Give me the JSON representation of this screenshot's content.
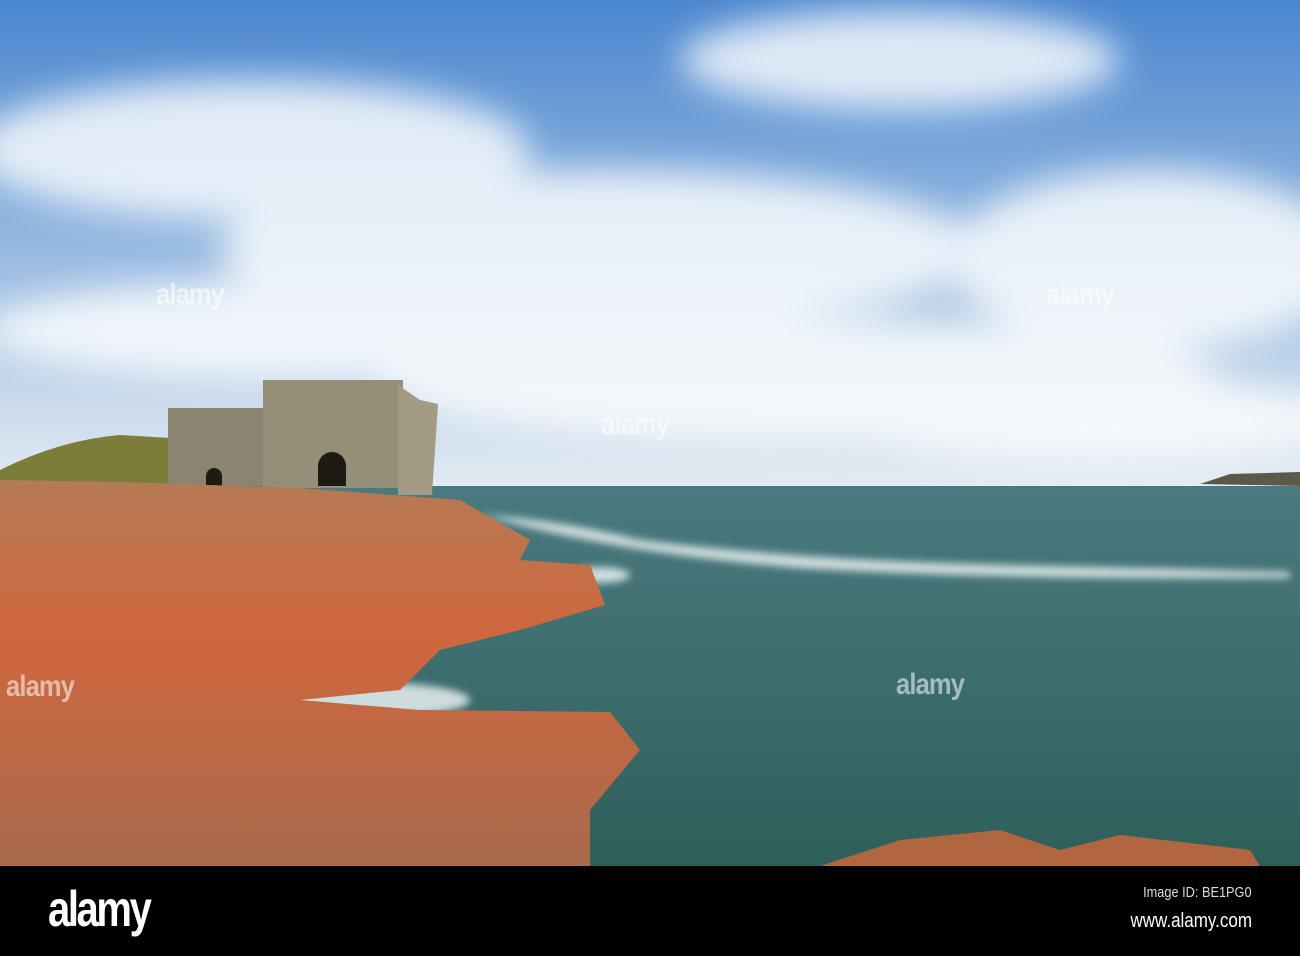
{
  "photo": {
    "subject": "coastal-stone-building-on-red-cliffs",
    "colors": {
      "sky_top": "#3f7fd0",
      "sky_bottom": "#dfe9f2",
      "sea": "#3e6f6c",
      "rock": "#c2603a",
      "building": "#8a8472"
    }
  },
  "watermark": {
    "text": "alamy"
  },
  "footer": {
    "logo": "alamy",
    "image_id": "Image ID: BE1PG0",
    "website": "www.alamy.com"
  }
}
